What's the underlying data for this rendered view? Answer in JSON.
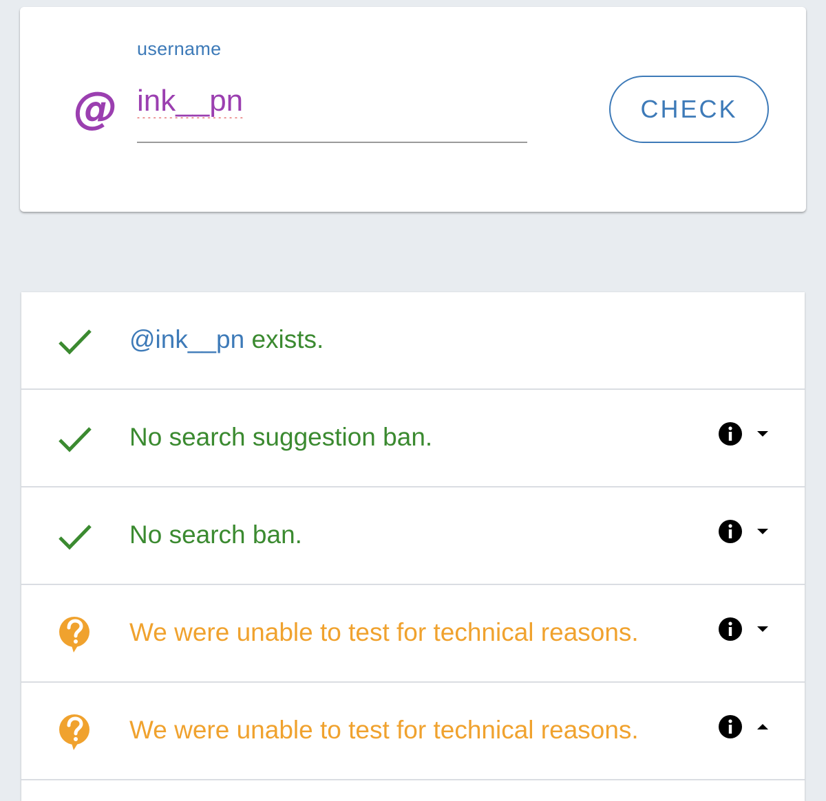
{
  "search": {
    "label": "username",
    "at_symbol": "@",
    "value": "ink__pn",
    "button_label": "CHECK"
  },
  "results": [
    {
      "status": "success",
      "icon": "check-icon",
      "handle": "@ink__pn",
      "text": " exists.",
      "expandable": false
    },
    {
      "status": "success",
      "icon": "check-icon",
      "text": "No search suggestion ban.",
      "expandable": true,
      "expanded": false
    },
    {
      "status": "success",
      "icon": "check-icon",
      "text": "No search ban.",
      "expandable": true,
      "expanded": false
    },
    {
      "status": "unknown",
      "icon": "question-bubble-icon",
      "text": "We were unable to test for technical reasons.",
      "expandable": true,
      "expanded": false
    },
    {
      "status": "unknown",
      "icon": "question-bubble-icon",
      "text": "We were unable to test for technical reasons.",
      "expandable": true,
      "expanded": true
    }
  ],
  "colors": {
    "background": "#e8ecf0",
    "accent_blue": "#3d7ab8",
    "accent_purple": "#9b3fb0",
    "success_green": "#3b8a30",
    "warning_orange": "#f0a22e"
  }
}
